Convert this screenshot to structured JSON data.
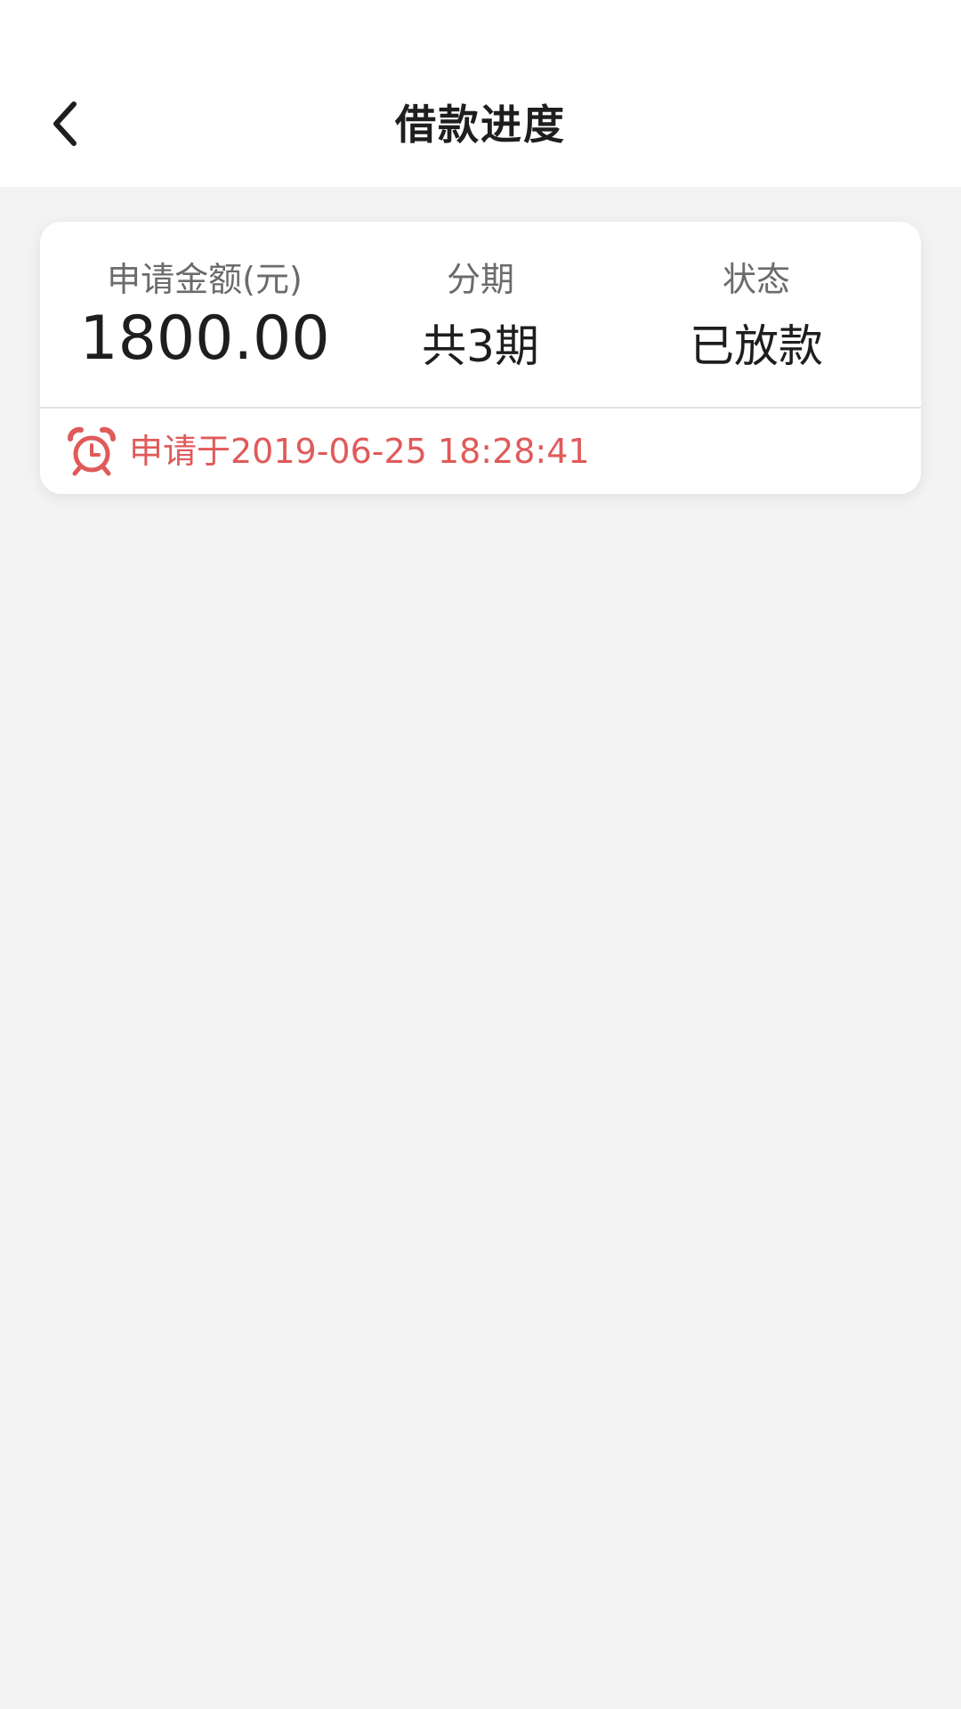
{
  "header": {
    "title": "借款进度",
    "back_icon": "chevron-left-icon"
  },
  "loan_card": {
    "amount_label": "申请金额(元)",
    "amount_value": "1800.00",
    "period_label": "分期",
    "period_value": "共3期",
    "status_label": "状态",
    "status_value": "已放款",
    "apply_time": "申请于2019-06-25 18:28:41",
    "apply_time_icon": "alarm-clock-icon"
  },
  "colors": {
    "accent_red": "#e05a5a",
    "background": "#f3f3f3",
    "card": "#ffffff"
  }
}
